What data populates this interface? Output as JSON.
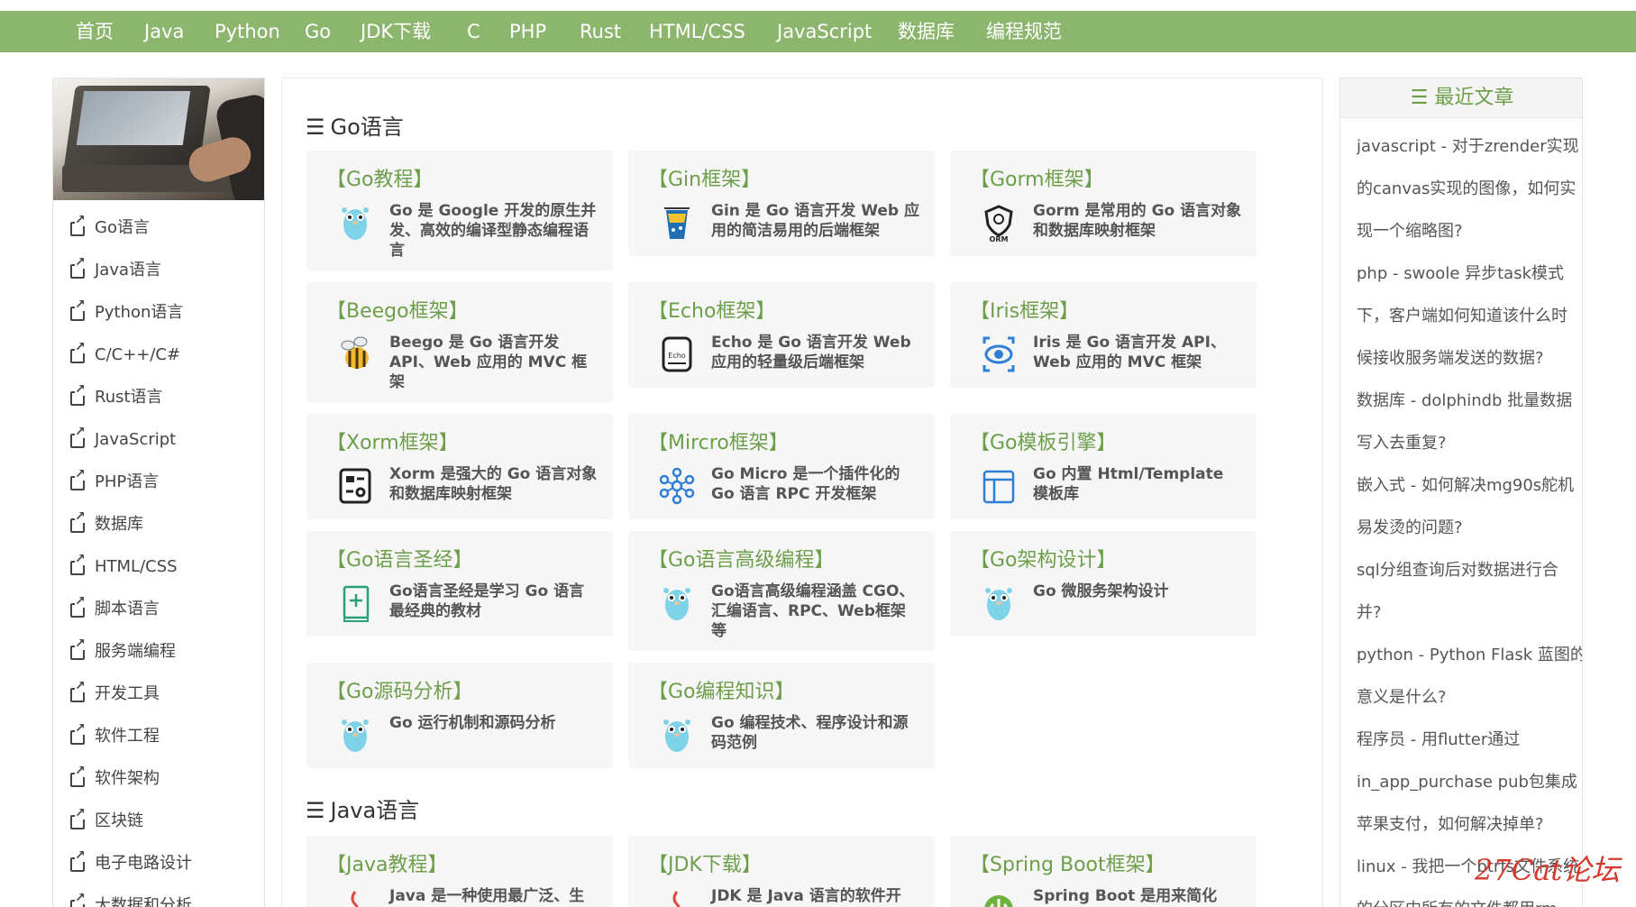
{
  "nav": [
    "首页",
    "Java",
    "Python",
    "Go",
    "JDK下载",
    "C",
    "PHP",
    "Rust",
    "HTML/CSS",
    "JavaScript",
    "数据库",
    "编程规范"
  ],
  "sidebar": {
    "items": [
      "Go语言",
      "Java语言",
      "Python语言",
      "C/C++/C#",
      "Rust语言",
      "JavaScript",
      "PHP语言",
      "数据库",
      "HTML/CSS",
      "脚本语言",
      "服务端编程",
      "开发工具",
      "软件工程",
      "软件架构",
      "区块链",
      "电子电路设计",
      "大数据和分析"
    ]
  },
  "sections": [
    {
      "title": "Go语言",
      "cards": [
        {
          "title": "【Go教程】",
          "desc": "Go 是 Google 开发的原生并发、高效的编译型静态编程语言",
          "icon": "gopher-icon"
        },
        {
          "title": "【Gin框架】",
          "desc": "Gin 是 Go 语言开发 Web 应用的简洁易用的后端框架",
          "icon": "gin-cocktail-icon"
        },
        {
          "title": "【Gorm框架】",
          "desc": "Gorm 是常用的 Go 语言对象和数据库映射框架",
          "icon": "orm-icon"
        },
        {
          "title": "【Beego框架】",
          "desc": "Beego 是 Go 语言开发 API、Web 应用的 MVC 框架",
          "icon": "bee-icon"
        },
        {
          "title": "【Echo框架】",
          "desc": "Echo 是 Go 语言开发 Web 应用的轻量级后端框架",
          "icon": "echo-icon"
        },
        {
          "title": "【Iris框架】",
          "desc": "Iris 是 Go 语言开发 API、Web 应用的 MVC 框架",
          "icon": "eye-icon"
        },
        {
          "title": "【Xorm框架】",
          "desc": "Xorm 是强大的 Go 语言对象和数据库映射框架",
          "icon": "xorm-icon"
        },
        {
          "title": "【Mircro框架】",
          "desc": "Go Micro 是一个插件化的 Go 语言 RPC 开发框架",
          "icon": "network-icon"
        },
        {
          "title": "【Go模板引擎】",
          "desc": "Go 内置 Html/Template 模板库",
          "icon": "layout-icon"
        },
        {
          "title": "【Go语言圣经】",
          "desc": "Go语言圣经是学习 Go 语言最经典的教材",
          "icon": "book-icon"
        },
        {
          "title": "【Go语言高级编程】",
          "desc": "Go语言高级编程涵盖 CGO、汇编语言、RPC、Web框架等",
          "icon": "gopher-icon"
        },
        {
          "title": "【Go架构设计】",
          "desc": "Go 微服务架构设计",
          "icon": "gopher-icon"
        },
        {
          "title": "【Go源码分析】",
          "desc": "Go 运行机制和源码分析",
          "icon": "gopher-icon"
        },
        {
          "title": "【Go编程知识】",
          "desc": "Go 编程技术、程序设计和源码范例",
          "icon": "gopher-icon"
        }
      ]
    },
    {
      "title": "Java语言",
      "cards": [
        {
          "title": "【Java教程】",
          "desc": "Java 是一种使用最广泛、生",
          "icon": "java-icon"
        },
        {
          "title": "【JDK下载】",
          "desc": "JDK 是 Java 语言的软件开",
          "icon": "java-icon"
        },
        {
          "title": "【Spring Boot框架】",
          "desc": "Spring Boot 是用来简化",
          "icon": "power-icon"
        }
      ]
    }
  ],
  "recent": {
    "title": "最近文章",
    "lines": [
      "javascript - 对于zrender实现",
      "的canvas实现的图像，如何实",
      "现一个缩略图?",
      "php - swoole 异步task模式",
      "下，客户端如何知道该什么时",
      "候接收服务端发送的数据?",
      "数据库 - dolphindb 批量数据",
      "写入去重复?",
      "嵌入式 - 如何解决mg90s舵机",
      "易发烫的问题?",
      "sql分组查询后对数据进行合",
      "并?",
      "python - Python Flask 蓝图的",
      "意义是什么?",
      "程序员 - 用flutter通过",
      "in_app_purchase pub包集成",
      "苹果支付，如何解决掉单?",
      "linux - 我把一个btrfs文件系统",
      "的分区中所有的文件都用rm -"
    ]
  },
  "watermark": "27Cat论坛",
  "colors": {
    "nav_bg": "#8cb66e",
    "accent": "#6d9f4a",
    "card_bg": "#f6f6f6"
  }
}
